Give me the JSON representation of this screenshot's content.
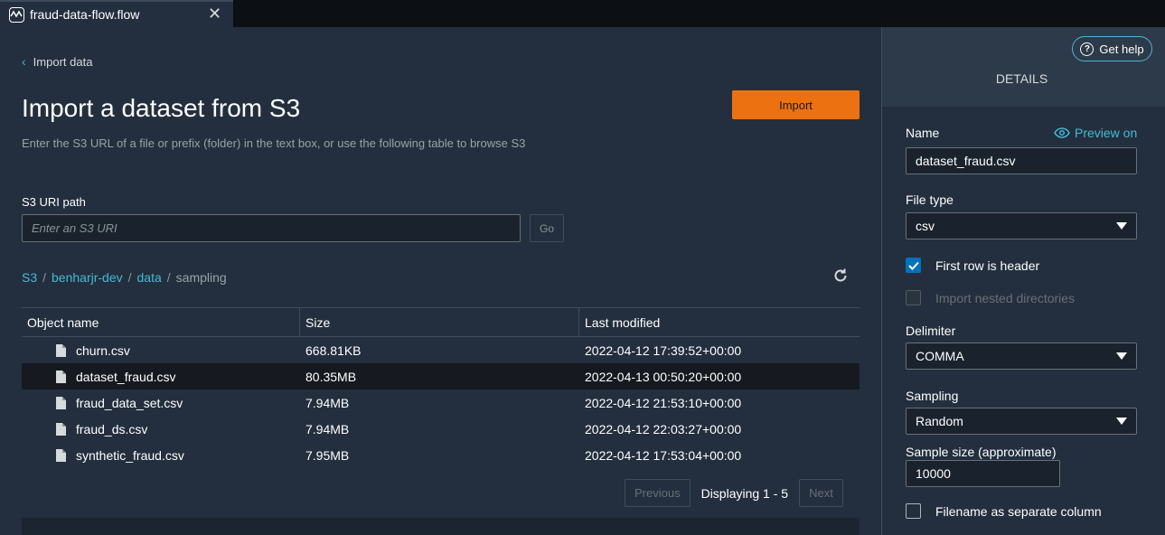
{
  "tab": {
    "title": "fraud-data-flow.flow",
    "icon": "flow-icon",
    "close": "✕"
  },
  "main": {
    "back_label": "Import data",
    "title": "Import a dataset from S3",
    "description": "Enter the S3 URL of a file or prefix (folder) in the text box, or use the following table to browse S3",
    "import_label": "Import",
    "s3_label": "S3 URI path",
    "s3_placeholder": "Enter an S3 URI",
    "go_label": "Go",
    "breadcrumb": {
      "root": "S3",
      "bucket": "benharjr-dev",
      "folder": "data",
      "current": "sampling",
      "sep": "/"
    },
    "table": {
      "headers": [
        "Object name",
        "Size",
        "Last modified"
      ],
      "rows": [
        {
          "name": "churn.csv",
          "size": "668.81KB",
          "modified": "2022-04-12 17:39:52+00:00"
        },
        {
          "name": "dataset_fraud.csv",
          "size": "80.35MB",
          "modified": "2022-04-13 00:50:20+00:00"
        },
        {
          "name": "fraud_data_set.csv",
          "size": "7.94MB",
          "modified": "2022-04-12 21:53:10+00:00"
        },
        {
          "name": "fraud_ds.csv",
          "size": "7.94MB",
          "modified": "2022-04-12 22:03:27+00:00"
        },
        {
          "name": "synthetic_fraud.csv",
          "size": "7.95MB",
          "modified": "2022-04-12 17:53:04+00:00"
        }
      ]
    },
    "pager": {
      "previous": "Previous",
      "status": "Displaying 1 - 5",
      "next": "Next"
    }
  },
  "panel": {
    "help_label": "Get help",
    "title": "DETAILS",
    "name_label": "Name",
    "preview_label": "Preview on",
    "name_value": "dataset_fraud.csv",
    "filetype_label": "File type",
    "filetype_value": "csv",
    "first_row_header": "First row is header",
    "import_nested": "Import nested directories",
    "delimiter_label": "Delimiter",
    "delimiter_value": "COMMA",
    "sampling_label": "Sampling",
    "sampling_value": "Random",
    "sample_size_label": "Sample size (approximate)",
    "sample_size_value": "10000",
    "filename_column": "Filename as separate column"
  },
  "colors": {
    "accent": "#44b9d6",
    "primary_button": "#ec7211",
    "checkbox": "#0073bb"
  }
}
